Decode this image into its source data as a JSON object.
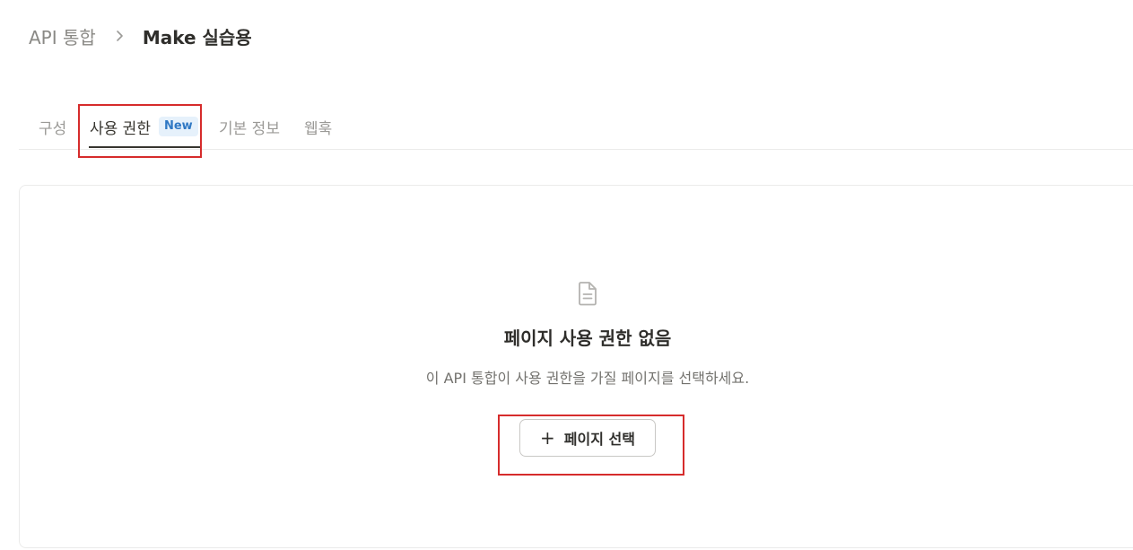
{
  "breadcrumb": {
    "parent": "API 통합",
    "current": "Make 실습용",
    "separator_icon": "chevron-right-icon"
  },
  "tabs": [
    {
      "label": "구성",
      "active": false
    },
    {
      "label": "사용 권한",
      "active": true,
      "badge": "New"
    },
    {
      "label": "기본 정보",
      "active": false
    },
    {
      "label": "웹훅",
      "active": false
    }
  ],
  "empty_state": {
    "icon": "document-icon",
    "title": "페이지 사용 권한 없음",
    "description": "이 API 통합이 사용 권한을 가질 페이지를 선택하세요.",
    "button_label": "페이지 선택",
    "button_icon": "+"
  },
  "colors": {
    "highlight": "#d62c2c",
    "badge_text": "#2f78c4",
    "badge_bg": "#e6f1fb"
  }
}
